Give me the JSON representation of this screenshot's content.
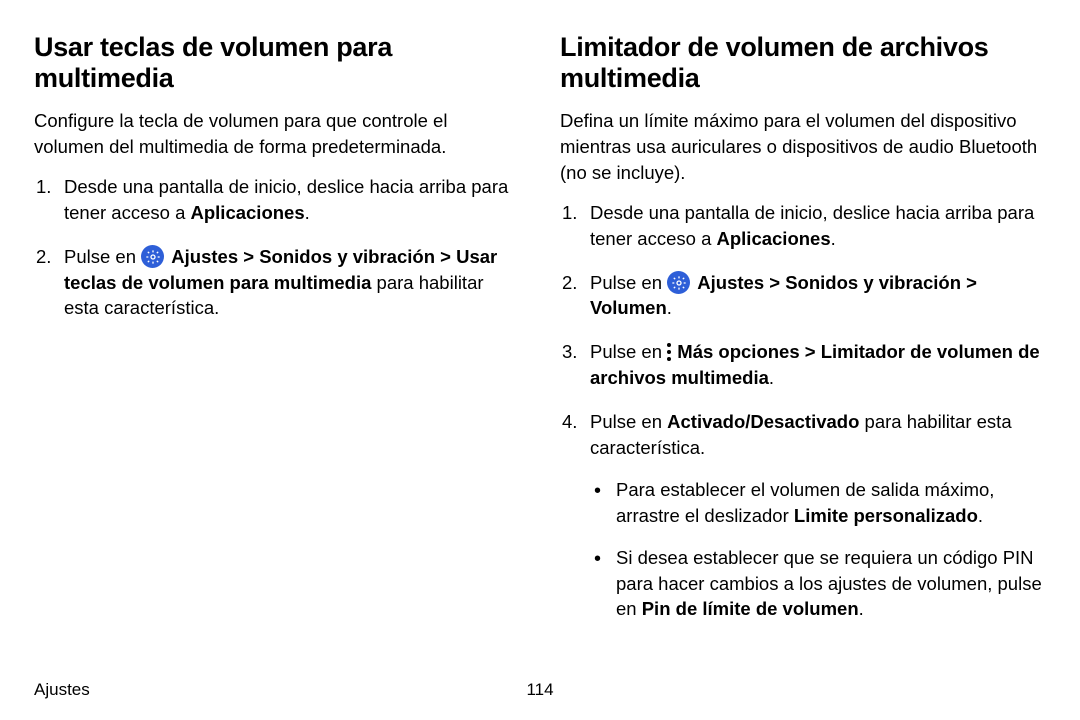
{
  "left": {
    "heading": "Usar teclas de volumen para multimedia",
    "lead": "Configure la tecla de volumen para que controle el volumen del multimedia de forma predeterminada.",
    "step1_a": "Desde una pantalla de inicio, deslice hacia arriba para tener acceso a ",
    "step1_b": "Aplicaciones",
    "step1_c": ".",
    "step2_a": "Pulse en ",
    "step2_b": "Ajustes",
    "step2_c": " > ",
    "step2_d": "Sonidos y vibración",
    "step2_e": " > ",
    "step2_f": "Usar teclas de volumen para multimedia",
    "step2_g": " para habilitar esta característica."
  },
  "right": {
    "heading": "Limitador de volumen de archivos multimedia",
    "lead": "Defina un límite máximo para el volumen del dispositivo mientras usa auriculares o dispositivos de audio Bluetooth (no se incluye).",
    "step1_a": "Desde una pantalla de inicio, deslice hacia arriba para tener acceso a ",
    "step1_b": "Aplicaciones",
    "step1_c": ".",
    "step2_a": "Pulse en ",
    "step2_b": "Ajustes",
    "step2_c": " > ",
    "step2_d": "Sonidos y vibración",
    "step2_e": " > ",
    "step2_f": "Volumen",
    "step2_g": ".",
    "step3_a": "Pulse en ",
    "step3_b": "Más opciones",
    "step3_c": " > ",
    "step3_d": "Limitador de volumen de archivos multimedia",
    "step3_e": ".",
    "step4_a": "Pulse en ",
    "step4_b": "Activado/Desactivado",
    "step4_c": " para habilitar esta característica.",
    "sub1_a": "Para establecer el volumen de salida máximo, arrastre el deslizador ",
    "sub1_b": "Limite personalizado",
    "sub1_c": ".",
    "sub2_a": "Si desea establecer que se requiera un código PIN para hacer cambios a los ajustes de volumen, pulse en ",
    "sub2_b": "Pin de límite de volumen",
    "sub2_c": "."
  },
  "footer": {
    "section": "Ajustes",
    "page": "114"
  }
}
